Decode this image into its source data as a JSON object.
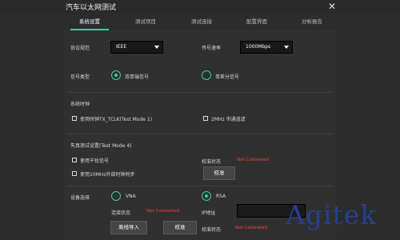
{
  "window": {
    "title": "汽车以太网测试",
    "close_icon": "close-icon"
  },
  "tabs": [
    {
      "label": "系统设置",
      "active": true
    },
    {
      "label": "测试项目",
      "active": false
    },
    {
      "label": "测试连接",
      "active": false
    },
    {
      "label": "配置界面",
      "active": false
    },
    {
      "label": "分析报告",
      "active": false
    }
  ],
  "protocol": {
    "label": "协议规范",
    "value": "IEEE"
  },
  "rate": {
    "label": "传号速率",
    "value": "1000Mbps"
  },
  "signal_type": {
    "label": "信号类型",
    "options": [
      "双单端信号",
      "单差分信号"
    ],
    "selected": 0
  },
  "clock": {
    "section": "系统时钟",
    "opt_txtclk": "使用时钟TX_TCLK(Test Mode 1)",
    "opt_2mhz": "2MHz 市通道滤"
  },
  "distortion": {
    "section": "失真测试设置(Test Mode 4)",
    "opt_interference": "使用干扰信号",
    "opt_10mhz": "使用10MHz外部时钟同步",
    "cal_status_label": "校准状态",
    "cal_status_value": "Not Calibrated",
    "calibrate_button": "校准"
  },
  "device": {
    "label": "设备选择",
    "options": [
      "VNA",
      "RSA"
    ],
    "selected": 1,
    "conn_status_label": "连接状态",
    "conn_status_value": "Not Connected",
    "ip_label": "IP地址",
    "ip_value": "",
    "cal_status_label": "校准状态",
    "cal_status_value": "Not Calibrated"
  },
  "buttons": {
    "offline_import": "离线导入",
    "calibrate": "校准"
  },
  "logo": {
    "text": "Agitek"
  },
  "colors": {
    "accent": "#27d6a4",
    "error": "#ff3b30",
    "background": "#2c2c2c",
    "logo": "#263f8f"
  }
}
